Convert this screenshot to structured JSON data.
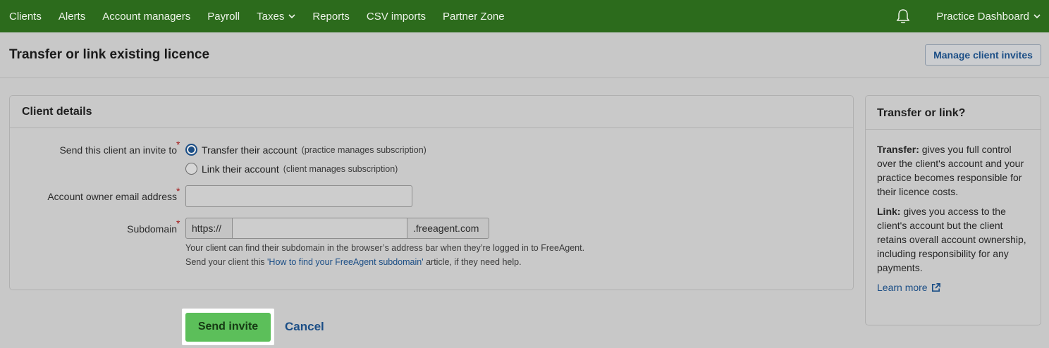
{
  "nav": {
    "items": [
      "Clients",
      "Alerts",
      "Account managers",
      "Payroll",
      "Taxes",
      "Reports",
      "CSV imports",
      "Partner Zone"
    ],
    "practice_label": "Practice Dashboard"
  },
  "header": {
    "title": "Transfer or link existing licence",
    "manage_invites_label": "Manage client invites"
  },
  "client_details": {
    "heading": "Client details",
    "invite_label": "Send this client an invite to",
    "options": [
      {
        "label": "Transfer their account",
        "hint": "(practice manages subscription)",
        "selected": true
      },
      {
        "label": "Link their account",
        "hint": "(client manages subscription)",
        "selected": false
      }
    ],
    "email_label": "Account owner email address",
    "email_value": "",
    "subdomain_label": "Subdomain",
    "subdomain_prefix": "https://",
    "subdomain_value": "",
    "subdomain_suffix": ".freeagent.com",
    "help_line1": "Your client can find their subdomain in the browser’s address bar when they’re logged in to FreeAgent.",
    "help_line2_pre": "Send your client this ",
    "help_line2_link": "'How to find your FreeAgent subdomain'",
    "help_line2_post": " article, if they need help.",
    "required_mark": "*"
  },
  "actions": {
    "send_label": "Send invite",
    "cancel_label": "Cancel"
  },
  "sidebar": {
    "heading": "Transfer or link?",
    "transfer_term": "Transfer:",
    "transfer_text": " gives you full control over the client's account and your practice becomes responsible for their licence costs.",
    "link_term": "Link:",
    "link_text": " gives you access to the client's account but the client retains overall account ownership, including responsibility for any payments.",
    "learn_more": "Learn more"
  },
  "colors": {
    "nav_bg": "#2c6b1c",
    "link": "#1b4e86",
    "primary_button": "#5cbf5a"
  }
}
